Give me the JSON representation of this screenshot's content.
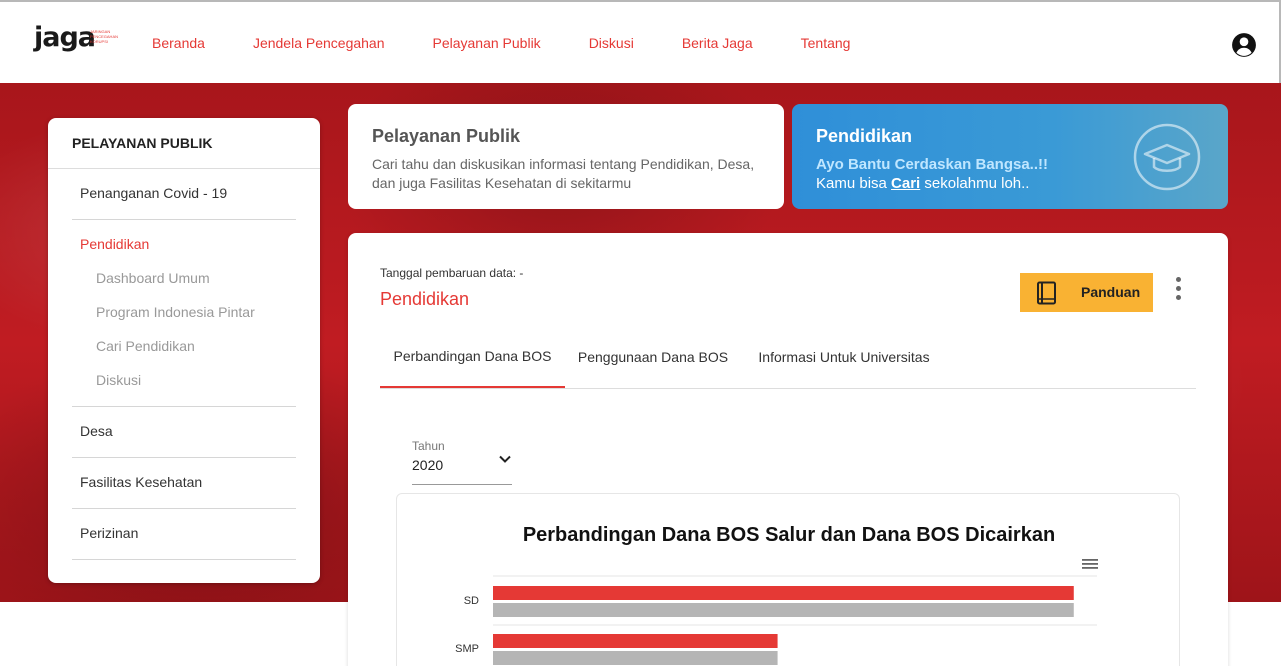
{
  "logo": {
    "text": "jaga",
    "tagline": "JARINGAN PENCEGAHAN KORUPSI"
  },
  "nav": {
    "items": [
      "Beranda",
      "Jendela Pencegahan",
      "Pelayanan Publik",
      "Diskusi",
      "Berita Jaga",
      "Tentang"
    ]
  },
  "sidebar": {
    "title": "PELAYANAN PUBLIK",
    "covid": "Penanganan Covid - 19",
    "pendidikan": "Pendidikan",
    "sub": [
      "Dashboard Umum",
      "Program Indonesia Pintar",
      "Cari Pendidikan",
      "Diskusi"
    ],
    "desa": "Desa",
    "faskes": "Fasilitas Kesehatan",
    "perizinan": "Perizinan"
  },
  "info_card": {
    "title": "Pelayanan Publik",
    "description": "Cari tahu dan diskusikan informasi tentang Pendidikan, Desa, dan juga Fasilitas Kesehatan di sekitarmu"
  },
  "edu_card": {
    "title": "Pendidikan",
    "line1": "Ayo Bantu Cerdaskan Bangsa..!!",
    "line2_prefix": "Kamu bisa ",
    "line2_link": "Cari",
    "line2_suffix": " sekolahmu loh.."
  },
  "main": {
    "update_label": "Tanggal pembaruan data: -",
    "title": "Pendidikan",
    "panduan_label": "Panduan",
    "tabs": [
      "Perbandingan Dana BOS",
      "Penggunaan Dana BOS",
      "Informasi Untuk Universitas"
    ],
    "active_tab": 0,
    "year": {
      "label": "Tahun",
      "value": "2020"
    }
  },
  "colors": {
    "accent": "#e53935",
    "hero": "#b3171d",
    "blue_card": "#2f8fd8",
    "button": "#f9b233",
    "bar_gray": "#b5b5b5"
  },
  "chart_data": {
    "type": "bar",
    "orientation": "horizontal",
    "title": "Perbandingan Dana BOS Salur dan Dana BOS Dicairkan",
    "categories": [
      "SD",
      "SMP"
    ],
    "series": [
      {
        "values": [
          100,
          49
        ],
        "color": "#e53935"
      },
      {
        "values": [
          100,
          49
        ],
        "color": "#b5b5b5"
      }
    ],
    "xlim": [
      0,
      104
    ]
  }
}
